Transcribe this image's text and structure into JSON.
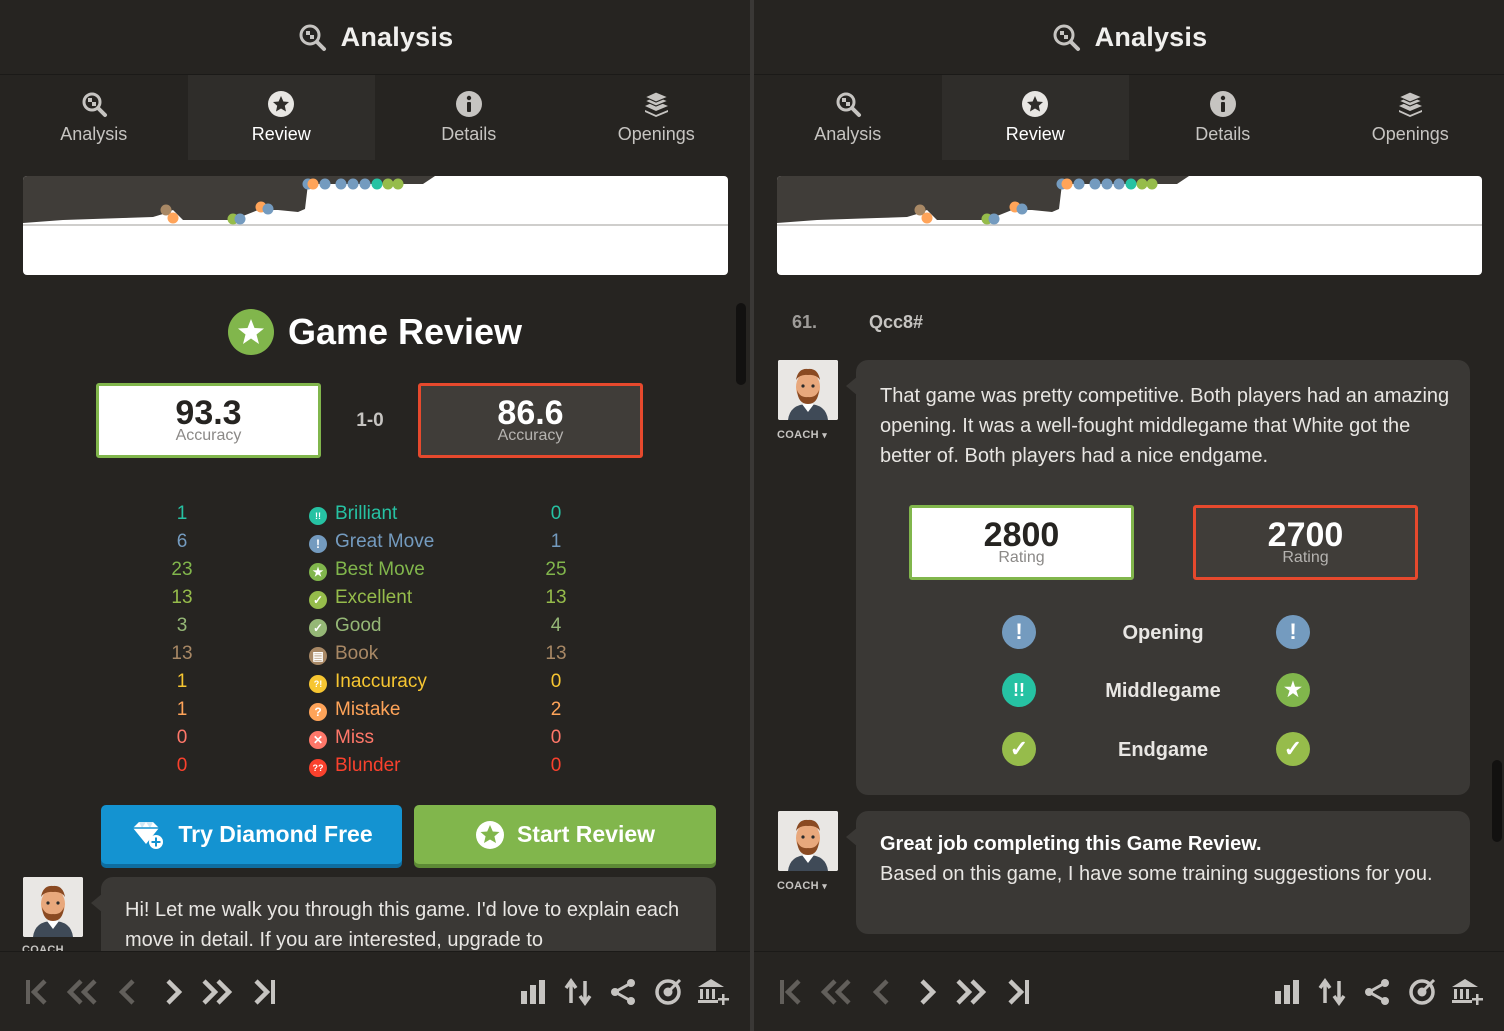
{
  "colors": {
    "brilliant": "#26c2a3",
    "great": "#749bbf",
    "best": "#81b64c",
    "excellent": "#96bc4b",
    "good": "#95b776",
    "book": "#a88865",
    "inaccuracy": "#f7c631",
    "mistake": "#ffa459",
    "miss": "#ff7769",
    "blunder": "#fa412d",
    "accent_green": "#81b64c",
    "accent_red": "#e6492d",
    "diamond_blue": "#1493d1"
  },
  "left": {
    "header": {
      "title": "Analysis",
      "icon": "magnifier-chess-icon"
    },
    "tabs": [
      {
        "label": "Analysis",
        "icon": "analysis-icon"
      },
      {
        "label": "Review",
        "icon": "star-icon"
      },
      {
        "label": "Details",
        "icon": "info-icon"
      },
      {
        "label": "Openings",
        "icon": "book-stack-icon"
      }
    ],
    "review": {
      "title": "Game Review",
      "white_accuracy": "93.3",
      "black_accuracy": "86.6",
      "accuracy_label": "Accuracy",
      "result": "1-0",
      "classifications": [
        {
          "name": "Brilliant",
          "white": "1",
          "black": "0",
          "symbol": "!!",
          "color_key": "brilliant"
        },
        {
          "name": "Great Move",
          "white": "6",
          "black": "1",
          "symbol": "!",
          "color_key": "great"
        },
        {
          "name": "Best Move",
          "white": "23",
          "black": "25",
          "symbol": "★",
          "color_key": "best"
        },
        {
          "name": "Excellent",
          "white": "13",
          "black": "13",
          "symbol": "👍",
          "color_key": "excellent"
        },
        {
          "name": "Good",
          "white": "3",
          "black": "4",
          "symbol": "✓",
          "color_key": "good"
        },
        {
          "name": "Book",
          "white": "13",
          "black": "13",
          "symbol": "📖",
          "color_key": "book"
        },
        {
          "name": "Inaccuracy",
          "white": "1",
          "black": "0",
          "symbol": "?!",
          "color_key": "inaccuracy"
        },
        {
          "name": "Mistake",
          "white": "1",
          "black": "2",
          "symbol": "?",
          "color_key": "mistake"
        },
        {
          "name": "Miss",
          "white": "0",
          "black": "0",
          "symbol": "✕",
          "color_key": "miss"
        },
        {
          "name": "Blunder",
          "white": "0",
          "black": "0",
          "symbol": "??",
          "color_key": "blunder"
        }
      ],
      "try_diamond_label": "Try Diamond Free",
      "start_review_label": "Start Review",
      "coach_label": "COACH",
      "coach_message": "Hi! Let me walk you through this game. I'd love to explain each move in detail. If you are interested, upgrade to"
    }
  },
  "right": {
    "header": {
      "title": "Analysis",
      "icon": "magnifier-chess-icon"
    },
    "tabs": [
      {
        "label": "Analysis",
        "icon": "analysis-icon"
      },
      {
        "label": "Review",
        "icon": "star-icon"
      },
      {
        "label": "Details",
        "icon": "info-icon"
      },
      {
        "label": "Openings",
        "icon": "book-stack-icon"
      }
    ],
    "move": {
      "number": "61.",
      "san": "Qcc8#"
    },
    "coach_label": "COACH",
    "summary_message": "That game was pretty competitive. Both players had an amazing opening. It was a well-fought middlegame that White got the better of. Both players had a nice endgame.",
    "white_rating": "2800",
    "black_rating": "2700",
    "rating_label": "Rating",
    "phases": [
      {
        "name": "Opening",
        "white_symbol": "!",
        "white_color": "great",
        "black_symbol": "!",
        "black_color": "great"
      },
      {
        "name": "Middlegame",
        "white_symbol": "!!",
        "white_color": "brilliant",
        "black_symbol": "★",
        "black_color": "best"
      },
      {
        "name": "Endgame",
        "white_symbol": "👍",
        "white_color": "excellent",
        "black_symbol": "👍",
        "black_color": "excellent"
      }
    ],
    "final_message_bold": "Great job completing this Game Review.",
    "final_message": "Based on this game, I have some training suggestions for you."
  },
  "footer": {
    "nav": [
      "first-move-icon",
      "previous-fast-icon",
      "previous-icon",
      "next-icon",
      "next-fast-icon",
      "last-move-icon"
    ],
    "tools": [
      "bar-chart-icon",
      "flip-board-icon",
      "share-icon",
      "target-icon",
      "add-to-library-icon"
    ]
  },
  "eval_graph": {
    "points": [
      {
        "move": 19,
        "class": "book"
      },
      {
        "move": 20,
        "class": "mistake"
      },
      {
        "move": 28,
        "class": "excellent"
      },
      {
        "move": 29,
        "class": "great"
      },
      {
        "move": 32,
        "class": "mistake"
      },
      {
        "move": 33,
        "class": "great"
      },
      {
        "move": 37,
        "class": "great"
      },
      {
        "move": 38,
        "class": "mistake"
      },
      {
        "move": 39,
        "class": "great"
      },
      {
        "move": 41,
        "class": "great"
      },
      {
        "move": 42,
        "class": "great"
      },
      {
        "move": 43,
        "class": "great"
      },
      {
        "move": 44,
        "class": "brilliant"
      },
      {
        "move": 45,
        "class": "excellent"
      },
      {
        "move": 46,
        "class": "excellent"
      }
    ]
  }
}
